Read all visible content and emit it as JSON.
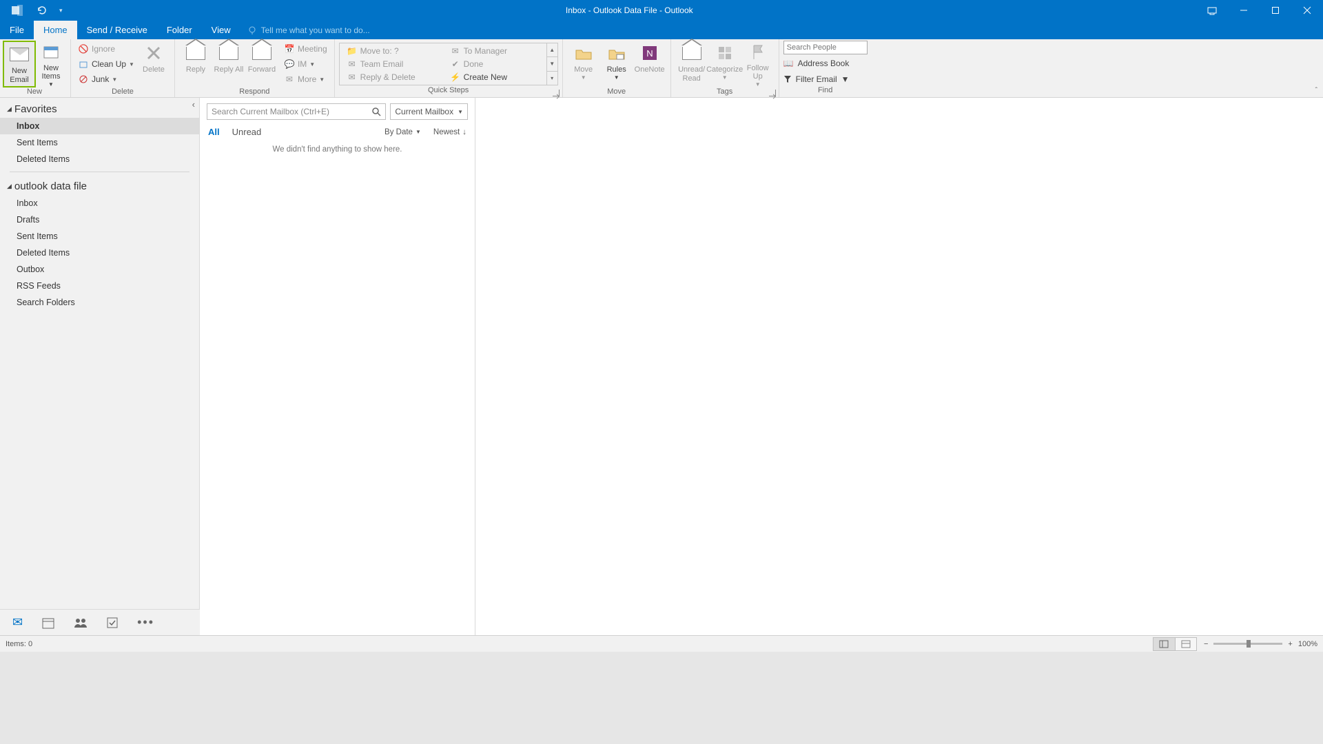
{
  "window": {
    "title": "Inbox - Outlook Data File - Outlook"
  },
  "tabs": {
    "file": "File",
    "home": "Home",
    "sendreceive": "Send / Receive",
    "folder": "Folder",
    "view": "View",
    "tellme": "Tell me what you want to do..."
  },
  "ribbon": {
    "new": {
      "label": "New",
      "new_email": "New Email",
      "new_items": "New Items"
    },
    "delete": {
      "label": "Delete",
      "ignore": "Ignore",
      "cleanup": "Clean Up",
      "junk": "Junk",
      "delete": "Delete"
    },
    "respond": {
      "label": "Respond",
      "reply": "Reply",
      "reply_all": "Reply All",
      "forward": "Forward",
      "meeting": "Meeting",
      "im": "IM",
      "more": "More"
    },
    "quicksteps": {
      "label": "Quick Steps",
      "moveto": "Move to: ?",
      "team_email": "Team Email",
      "reply_delete": "Reply & Delete",
      "to_manager": "To Manager",
      "done": "Done",
      "create_new": "Create New"
    },
    "move": {
      "label": "Move",
      "move": "Move",
      "rules": "Rules",
      "onenote": "OneNote"
    },
    "tags": {
      "label": "Tags",
      "unread": "Unread/ Read",
      "categorize": "Categorize",
      "followup": "Follow Up"
    },
    "find": {
      "label": "Find",
      "search_placeholder": "Search People",
      "address_book": "Address Book",
      "filter_email": "Filter Email"
    }
  },
  "nav": {
    "favorites": {
      "title": "Favorites",
      "inbox": "Inbox",
      "sent": "Sent Items",
      "deleted": "Deleted Items"
    },
    "datafile": {
      "title": "outlook data file",
      "inbox": "Inbox",
      "drafts": "Drafts",
      "sent": "Sent Items",
      "deleted": "Deleted Items",
      "outbox": "Outbox",
      "rss": "RSS Feeds",
      "search": "Search Folders"
    }
  },
  "list": {
    "search_placeholder": "Search Current Mailbox (Ctrl+E)",
    "scope": "Current Mailbox",
    "all": "All",
    "unread": "Unread",
    "by_date": "By Date",
    "newest": "Newest",
    "empty": "We didn't find anything to show here."
  },
  "status": {
    "items": "Items: 0",
    "zoom": "100%"
  }
}
